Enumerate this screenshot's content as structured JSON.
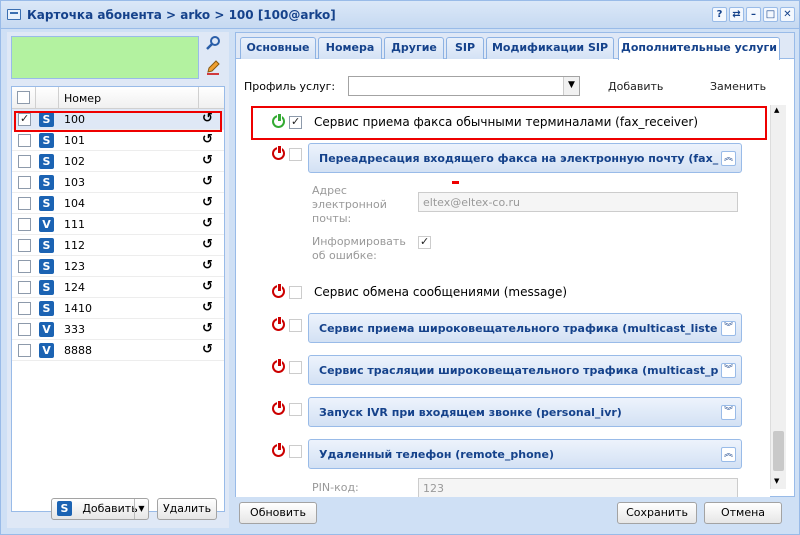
{
  "window": {
    "title": "Карточка абонента > arko > 100 [100@arko]",
    "controls": [
      "?",
      "⇄",
      "–",
      "□",
      "✕"
    ]
  },
  "left": {
    "header_number": "Номер",
    "rows": [
      {
        "type": "S",
        "number": "100",
        "checked": true
      },
      {
        "type": "S",
        "number": "101",
        "checked": false
      },
      {
        "type": "S",
        "number": "102",
        "checked": false
      },
      {
        "type": "S",
        "number": "103",
        "checked": false
      },
      {
        "type": "S",
        "number": "104",
        "checked": false
      },
      {
        "type": "V",
        "number": "111",
        "checked": false
      },
      {
        "type": "S",
        "number": "112",
        "checked": false
      },
      {
        "type": "S",
        "number": "123",
        "checked": false
      },
      {
        "type": "S",
        "number": "124",
        "checked": false
      },
      {
        "type": "S",
        "number": "1410",
        "checked": false
      },
      {
        "type": "V",
        "number": "333",
        "checked": false
      },
      {
        "type": "V",
        "number": "8888",
        "checked": false
      }
    ],
    "add_label": "Добавить",
    "delete_label": "Удалить"
  },
  "tabs": [
    "Основные",
    "Номера",
    "Другие",
    "SIP",
    "Модификации SIP",
    "Дополнительные услуги"
  ],
  "profile": {
    "label": "Профиль услуг:",
    "value": "",
    "add_label": "Добавить",
    "replace_label": "Заменить"
  },
  "services": {
    "fax_receiver": "Сервис приема факса обычными терминалами (fax_receiver)",
    "fax_forward": "Переадресация входящего факса на электронную почту (fax_",
    "email_label": "Адрес электронной почты:",
    "email_value": "eltex@eltex-co.ru",
    "notify_label": "Информировать об ошибке:",
    "message": "Сервис обмена сообщениями (message)",
    "multicast_listen": "Сервис приема широковещательного трафика (multicast_liste",
    "multicast_pub": "Сервис трасляции широковещательного трафика (multicast_p",
    "personal_ivr": "Запуск IVR при входящем звонке (personal_ivr)",
    "remote_phone": "Удаленный телефон (remote_phone)",
    "pin_label": "PIN-код:",
    "pin_value": "123"
  },
  "footer": {
    "refresh_label": "Обновить",
    "save_label": "Сохранить",
    "cancel_label": "Отмена"
  }
}
